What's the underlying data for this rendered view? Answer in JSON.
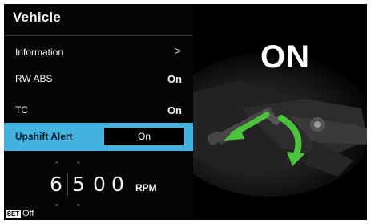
{
  "title": "Vehicle",
  "menu": {
    "information": {
      "label": "Information",
      "chevron": ">"
    },
    "rw_abs": {
      "label": "RW ABS",
      "value": "On"
    },
    "tc": {
      "label": "TC",
      "value": "On"
    },
    "upshift_alert": {
      "label": "Upshift Alert",
      "value": "On"
    }
  },
  "rpm": {
    "digits": [
      "6",
      "5",
      "0",
      "0"
    ],
    "unit": "RPM"
  },
  "footer": {
    "badge": "SET",
    "label": "Off"
  },
  "illustration": {
    "status_text": "ON",
    "icon": "shift-lever-arrow-icon"
  },
  "colors": {
    "highlight": "#42b2df",
    "arrow_green": "#4cc23c",
    "background": "#000000"
  }
}
